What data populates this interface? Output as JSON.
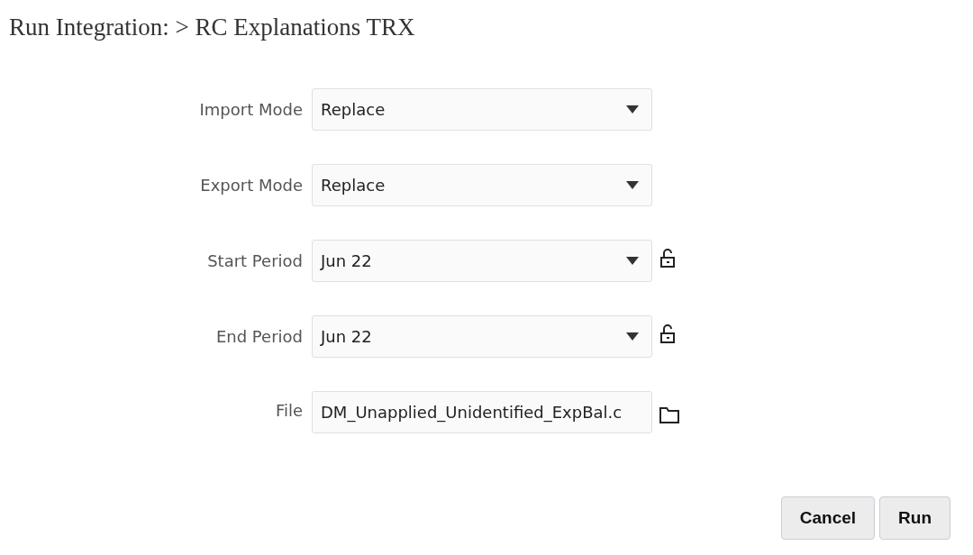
{
  "page": {
    "title": "Run Integration: > RC Explanations TRX"
  },
  "fields": [
    {
      "label": "Import Mode",
      "kind": "select",
      "value": "Replace"
    },
    {
      "label": "Export Mode",
      "kind": "select",
      "value": "Replace"
    },
    {
      "label": "Start Period",
      "kind": "select",
      "value": "Jun 22",
      "locked": false
    },
    {
      "label": "End Period",
      "kind": "select",
      "value": "Jun 22",
      "locked": false
    },
    {
      "label": "File",
      "kind": "file",
      "value": "DM_Unapplied_Unidentified_ExpBal.c"
    }
  ],
  "buttons": [
    "Cancel",
    "Run"
  ]
}
